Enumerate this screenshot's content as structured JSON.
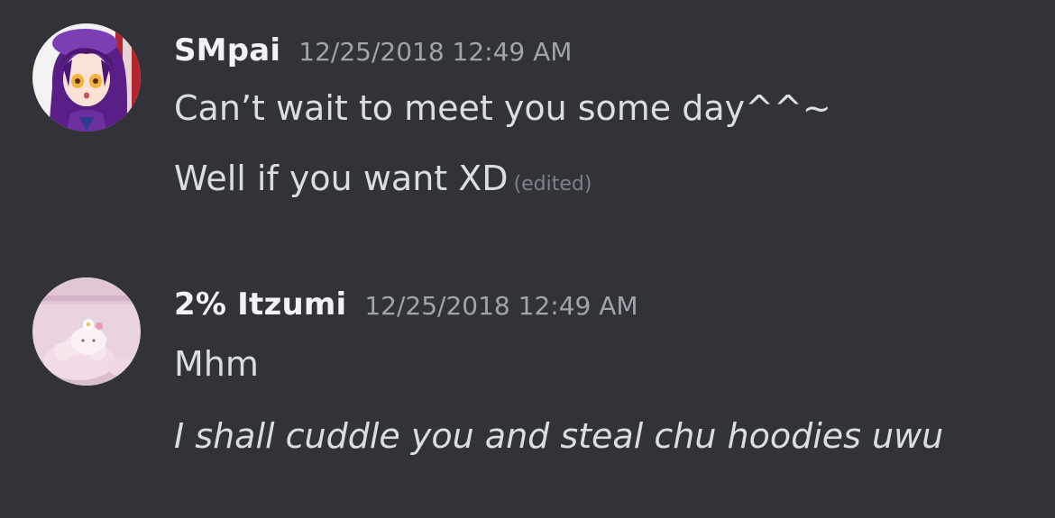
{
  "messages": [
    {
      "username": "SMpai",
      "timestamp": "12/25/2018 12:49 AM",
      "avatar_icon": "anime-girl-purple-hair-avatar",
      "lines": [
        {
          "text": "Can’t wait to meet you some day^^~"
        },
        {
          "text": "Well if you want XD",
          "edited_label": "(edited)"
        }
      ]
    },
    {
      "username": "2% Itzumi",
      "timestamp": "12/25/2018 12:49 AM",
      "avatar_icon": "pink-sheep-avatar",
      "lines": [
        {
          "text": "Mhm"
        },
        {
          "text": "I shall cuddle you and steal chu hoodies uwu",
          "italic": true
        }
      ]
    }
  ],
  "colors": {
    "background": "#313338",
    "username": "#f2f3f5",
    "message_text": "#dbdee1",
    "timestamp": "#a0a4ab",
    "edited": "#7d818a"
  }
}
